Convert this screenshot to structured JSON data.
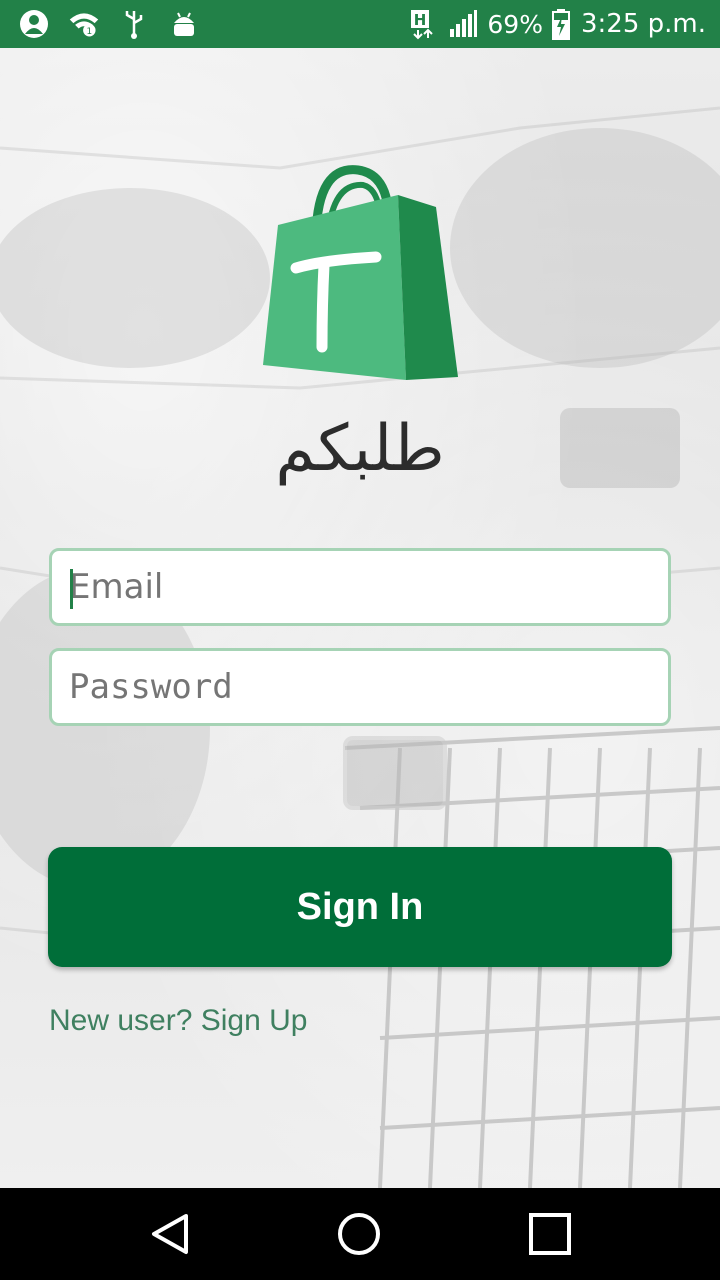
{
  "status_bar": {
    "battery_percent": "69%",
    "time": "3:25 p.m.",
    "icons": [
      "user-profile-icon",
      "wifi-icon",
      "usb-icon",
      "android-debug-icon",
      "hplus-network-icon",
      "signal-icon",
      "battery-charging-icon"
    ]
  },
  "app": {
    "brand_name": "طلبكم",
    "logo_letter": "T"
  },
  "form": {
    "email_placeholder": "Email",
    "email_value": "",
    "password_placeholder": "Password",
    "password_value": ""
  },
  "actions": {
    "sign_in_label": "Sign In",
    "sign_up_link": "New user? Sign Up"
  },
  "nav": {
    "icons": [
      "back-icon",
      "home-icon",
      "recents-icon"
    ]
  },
  "colors": {
    "status_bar": "#228148",
    "primary_button": "#006e39",
    "field_border": "#a6d3b5",
    "link": "#3f8060",
    "logo_light": "#4dba7f",
    "logo_dark": "#1f8a4c"
  }
}
